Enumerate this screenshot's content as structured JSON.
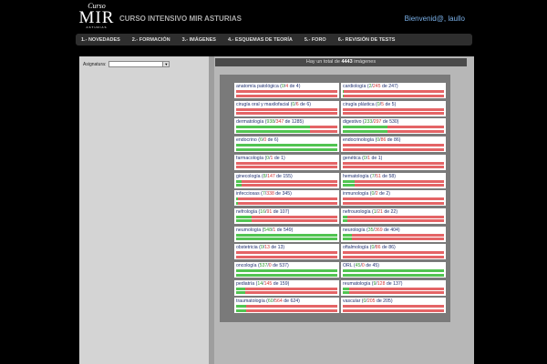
{
  "logo": {
    "line1": "Curso",
    "line2": "MIR",
    "line3": "ASTURIAS"
  },
  "site_title": "CURSO INTENSIVO MIR ASTURIAS",
  "welcome": "Bienvenid@, laullo",
  "nav": [
    "1.- NOVEDADES",
    "2.- FORMACIÓN",
    "3.- IMÁGENES",
    "4.- ESQUEMAS DE TEORÍA",
    "5.- FORO",
    "6.- REVISIÓN DE TESTS"
  ],
  "sidebar": {
    "subject_label": "Asignatura:",
    "subject_value": ""
  },
  "summary": {
    "prefix": "Hay un total de",
    "count": "4443",
    "suffix": "imágenes"
  },
  "colors": {
    "correct": "#51c451",
    "wrong": "#e46466",
    "label": "#1e2f70"
  },
  "subjects": [
    {
      "name": "anatomía patológica",
      "correct": 0,
      "wrong": 4,
      "total": 4
    },
    {
      "name": "cardiología",
      "correct": 2,
      "wrong": 245,
      "total": 247
    },
    {
      "name": "cirugía oral y maxilofacial",
      "correct": 0,
      "wrong": 6,
      "total": 6
    },
    {
      "name": "cirugía plástica",
      "correct": 0,
      "wrong": 5,
      "total": 5
    },
    {
      "name": "dermatología",
      "correct": 938,
      "wrong": 347,
      "total": 1285
    },
    {
      "name": "digestivo",
      "correct": 233,
      "wrong": 297,
      "total": 530
    },
    {
      "name": "endocrino",
      "correct": 6,
      "wrong": 0,
      "total": 6
    },
    {
      "name": "endocrinología",
      "correct": 0,
      "wrong": 86,
      "total": 86
    },
    {
      "name": "farmacología",
      "correct": 0,
      "wrong": 1,
      "total": 1
    },
    {
      "name": "genética",
      "correct": 0,
      "wrong": 1,
      "total": 1
    },
    {
      "name": "ginecología",
      "correct": 8,
      "wrong": 147,
      "total": 155
    },
    {
      "name": "hematología",
      "correct": 7,
      "wrong": 51,
      "total": 58
    },
    {
      "name": "infecciosas",
      "correct": 7,
      "wrong": 338,
      "total": 345
    },
    {
      "name": "inmunología",
      "correct": 0,
      "wrong": 2,
      "total": 2
    },
    {
      "name": "nefrología",
      "correct": 16,
      "wrong": 91,
      "total": 107
    },
    {
      "name": "nefrourología",
      "correct": 1,
      "wrong": 21,
      "total": 22
    },
    {
      "name": "neumología",
      "correct": 548,
      "wrong": 1,
      "total": 549
    },
    {
      "name": "neurología",
      "correct": 35,
      "wrong": 369,
      "total": 404
    },
    {
      "name": "obstetricia",
      "correct": 0,
      "wrong": 13,
      "total": 13
    },
    {
      "name": "oftalmología",
      "correct": 0,
      "wrong": 86,
      "total": 86
    },
    {
      "name": "oncología",
      "correct": 537,
      "wrong": 0,
      "total": 537
    },
    {
      "name": "ORL",
      "correct": 45,
      "wrong": 0,
      "total": 45
    },
    {
      "name": "pediatría",
      "correct": 14,
      "wrong": 145,
      "total": 159
    },
    {
      "name": "reumatología",
      "correct": 9,
      "wrong": 128,
      "total": 137
    },
    {
      "name": "traumatología",
      "correct": 60,
      "wrong": 564,
      "total": 624
    },
    {
      "name": "vascular",
      "correct": 0,
      "wrong": 205,
      "total": 205
    }
  ]
}
